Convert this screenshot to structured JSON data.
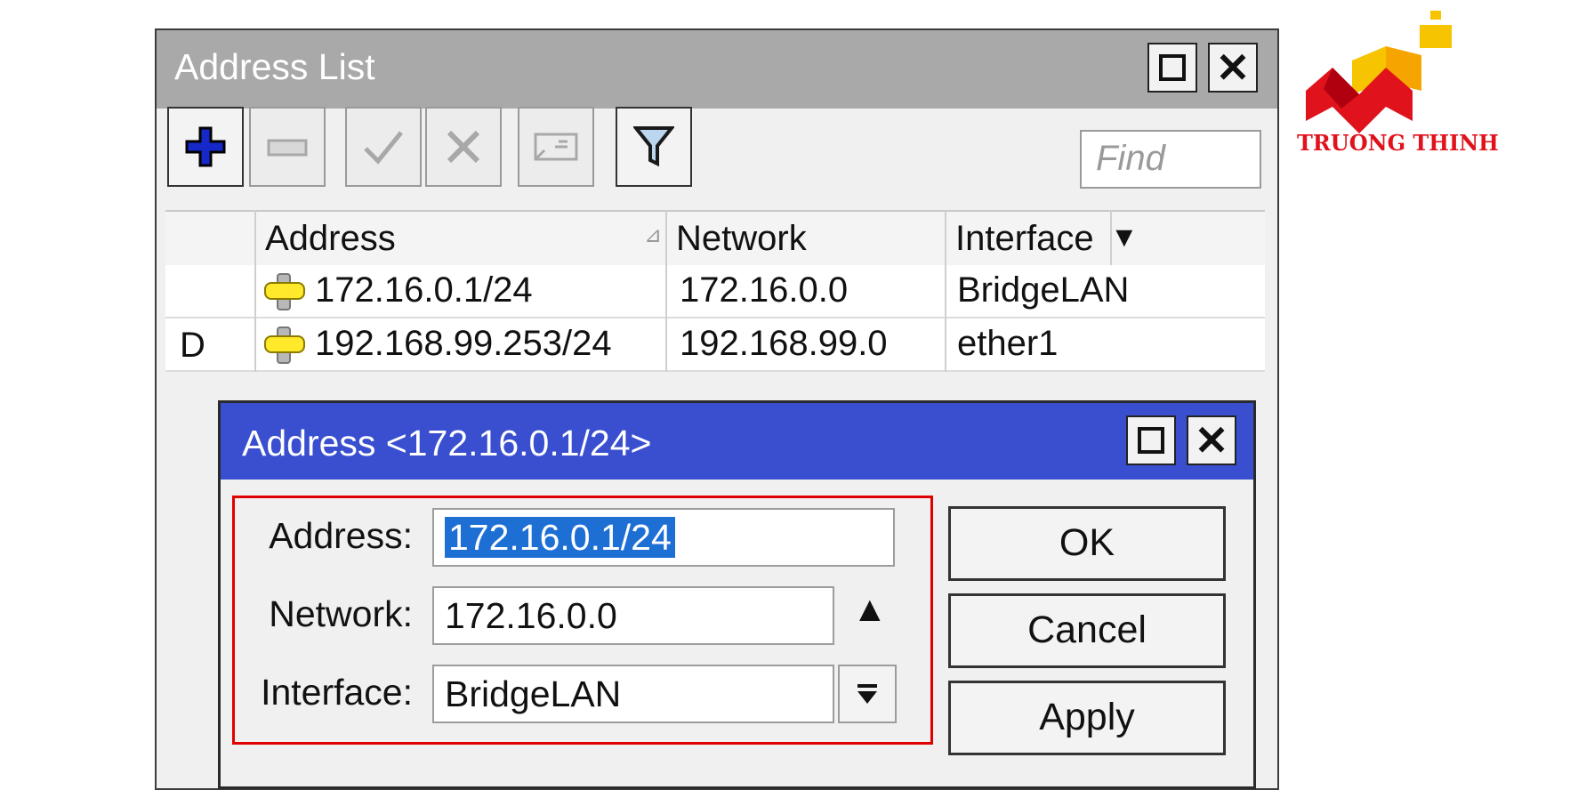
{
  "address_list": {
    "title": "Address List",
    "find_placeholder": "Find",
    "toolbar": {
      "add": "add-icon",
      "remove": "remove-icon",
      "enable": "check-icon",
      "disable": "cross-icon",
      "comment": "comment-icon",
      "filter": "filter-icon"
    },
    "columns": [
      "Address",
      "Network",
      "Interface"
    ],
    "rows": [
      {
        "flag": "",
        "address": "172.16.0.1/24",
        "network": "172.16.0.0",
        "interface": "BridgeLAN"
      },
      {
        "flag": "D",
        "address": "192.168.99.253/24",
        "network": "192.168.99.0",
        "interface": "ether1"
      }
    ]
  },
  "address_dialog": {
    "title": "Address <172.16.0.1/24>",
    "fields": {
      "address_label": "Address:",
      "address_value": "172.16.0.1/24",
      "network_label": "Network:",
      "network_value": "172.16.0.0",
      "interface_label": "Interface:",
      "interface_value": "BridgeLAN"
    },
    "buttons": {
      "ok": "OK",
      "cancel": "Cancel",
      "apply": "Apply"
    }
  },
  "logo": {
    "text": "TRUONG THINH"
  },
  "colors": {
    "dialog_title": "#3a4fcf",
    "window_title": "#a9a9a9",
    "highlight_box": "#e00000",
    "selection": "#1e6fd4",
    "logo_red": "#e0121c",
    "logo_yellow": "#f6c400"
  }
}
